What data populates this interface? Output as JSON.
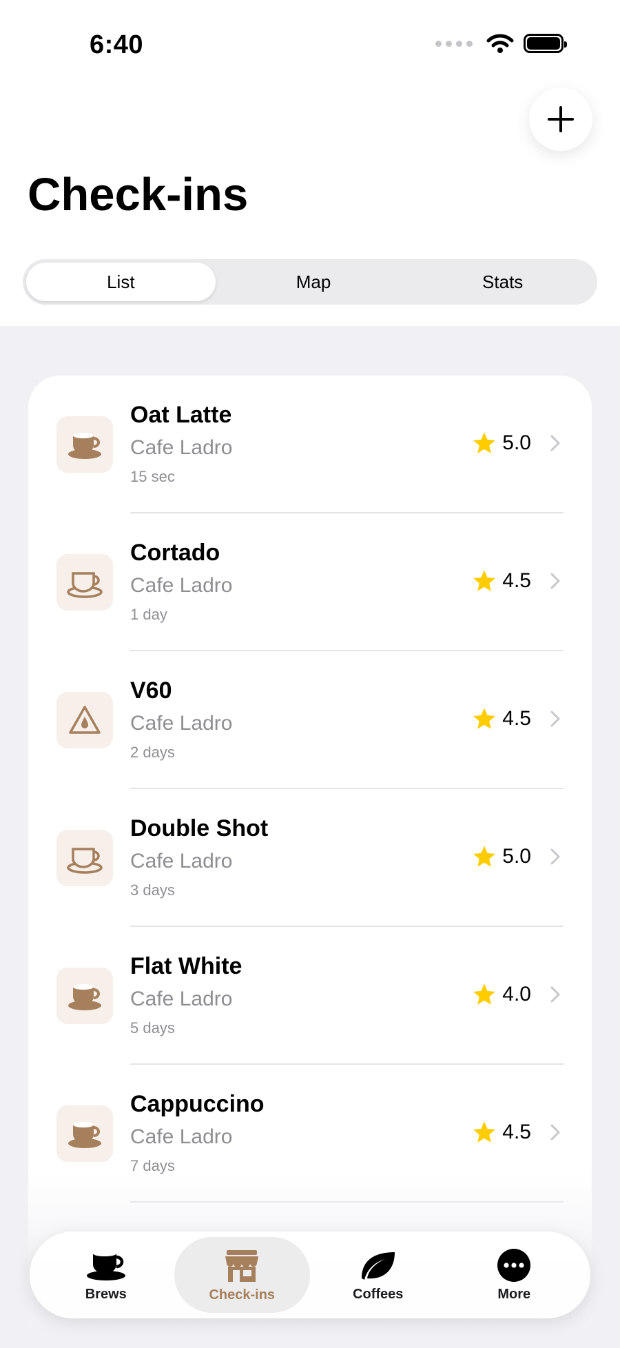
{
  "status": {
    "time": "6:40"
  },
  "header": {
    "title": "Check-ins"
  },
  "segments": [
    {
      "label": "List",
      "active": true
    },
    {
      "label": "Map",
      "active": false
    },
    {
      "label": "Stats",
      "active": false
    }
  ],
  "checkins": [
    {
      "title": "Oat Latte",
      "place": "Cafe Ladro",
      "time": "15 sec",
      "rating": "5.0",
      "icon": "milk-coffee-cup-icon",
      "filled": true
    },
    {
      "title": "Cortado",
      "place": "Cafe Ladro",
      "time": "1 day",
      "rating": "4.5",
      "icon": "coffee-cup-icon",
      "filled": false
    },
    {
      "title": "V60",
      "place": "Cafe Ladro",
      "time": "2 days",
      "rating": "4.5",
      "icon": "pour-over-icon",
      "filled": false
    },
    {
      "title": "Double Shot",
      "place": "Cafe Ladro",
      "time": "3 days",
      "rating": "5.0",
      "icon": "coffee-cup-icon",
      "filled": false
    },
    {
      "title": "Flat White",
      "place": "Cafe Ladro",
      "time": "5 days",
      "rating": "4.0",
      "icon": "milk-coffee-cup-icon",
      "filled": true
    },
    {
      "title": "Cappuccino",
      "place": "Cafe Ladro",
      "time": "7 days",
      "rating": "4.5",
      "icon": "milk-coffee-cup-icon",
      "filled": true
    }
  ],
  "tabs": [
    {
      "label": "Brews",
      "icon": "coffee-cup-icon",
      "active": false
    },
    {
      "label": "Check-ins",
      "icon": "storefront-icon",
      "active": true
    },
    {
      "label": "Coffees",
      "icon": "leaf-icon",
      "active": false
    },
    {
      "label": "More",
      "icon": "more-icon",
      "active": false
    }
  ],
  "colors": {
    "accent": "#a67f5c",
    "star": "#ffcc00",
    "icon_tile": "#f6efea",
    "secondary_text": "#8e8e93"
  }
}
